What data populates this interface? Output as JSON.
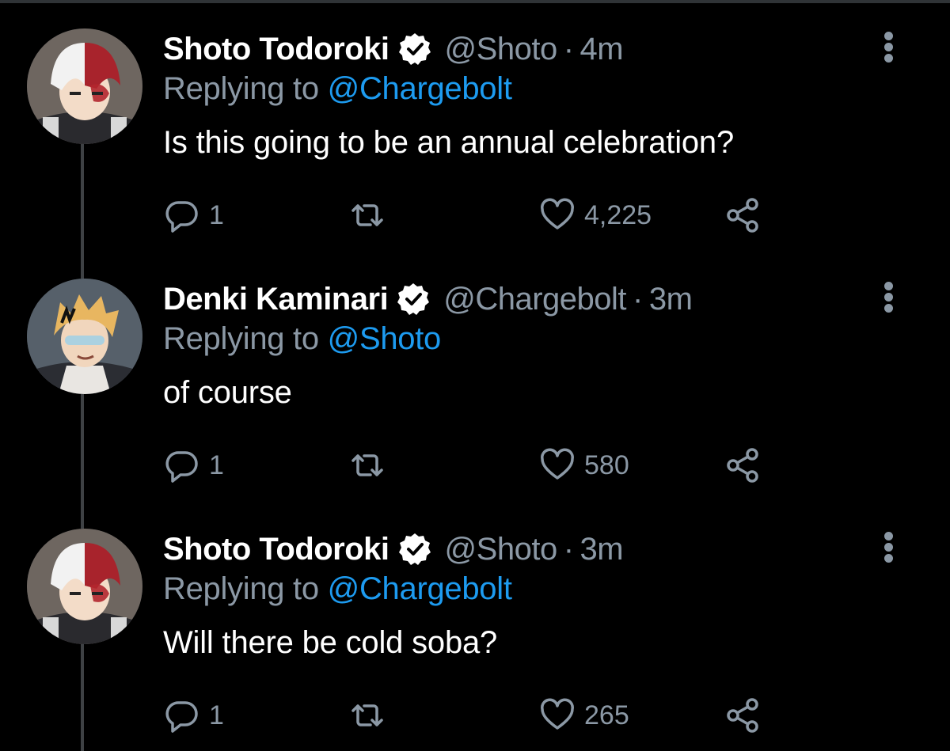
{
  "colors": {
    "background": "#000000",
    "name": "#ffffff",
    "muted": "#8b98a5",
    "link": "#1d9bf0",
    "thread_line": "#3e4144"
  },
  "icons": {
    "reply": "speech-bubble-icon",
    "retweet": "retweet-icon",
    "like": "heart-icon",
    "share": "share-icon",
    "verified": "verified-badge-icon",
    "more": "three-dots-vertical-icon"
  },
  "tweets": [
    {
      "name": "Shoto Todoroki",
      "handle": "@Shoto",
      "separator": "·",
      "time": "4m",
      "replying_label": "Replying to",
      "replying_to": "@Chargebolt",
      "text": "Is this going to be an annual celebration?",
      "replies": "1",
      "likes": "4,225"
    },
    {
      "name": "Denki Kaminari",
      "handle": "@Chargebolt",
      "separator": "·",
      "time": "3m",
      "replying_label": "Replying to",
      "replying_to": "@Shoto",
      "text": "of course",
      "replies": "1",
      "likes": "580"
    },
    {
      "name": "Shoto Todoroki",
      "handle": "@Shoto",
      "separator": "·",
      "time": "3m",
      "replying_label": "Replying to",
      "replying_to": "@Chargebolt",
      "text": "Will there be cold soba?",
      "replies": "1",
      "likes": "265"
    }
  ]
}
